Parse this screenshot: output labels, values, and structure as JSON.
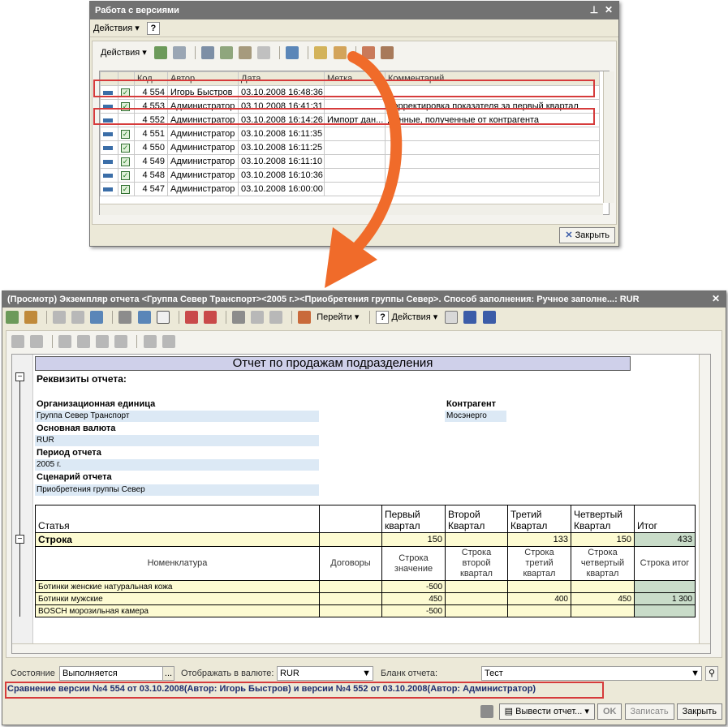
{
  "versions_window": {
    "title": "Работа с версиями",
    "menu_actions": "Действия",
    "toolbar_actions": "Действия",
    "help": "?",
    "columns": [
      "Код",
      "Автор",
      "Дата",
      "Метка",
      "Комментарий"
    ],
    "rows": [
      {
        "code": "4 554",
        "author": "Игорь Быстров",
        "date": "03.10.2008 16:48:36",
        "mark": "",
        "comment": "",
        "checked": true
      },
      {
        "code": "4 553",
        "author": "Администратор",
        "date": "03.10.2008 16:41:31",
        "mark": "",
        "comment": "Корректировка показателя за первый квартал",
        "checked": true
      },
      {
        "code": "4 552",
        "author": "Администратор",
        "date": "03.10.2008 16:14:26",
        "mark": "Импорт дан...",
        "comment": "Данные, полученные от контрагента",
        "checked": false
      },
      {
        "code": "4 551",
        "author": "Администратор",
        "date": "03.10.2008 16:11:35",
        "mark": "",
        "comment": "",
        "checked": true
      },
      {
        "code": "4 550",
        "author": "Администратор",
        "date": "03.10.2008 16:11:25",
        "mark": "",
        "comment": "",
        "checked": true
      },
      {
        "code": "4 549",
        "author": "Администратор",
        "date": "03.10.2008 16:11:10",
        "mark": "",
        "comment": "",
        "checked": true
      },
      {
        "code": "4 548",
        "author": "Администратор",
        "date": "03.10.2008 16:10:36",
        "mark": "",
        "comment": "",
        "checked": true
      },
      {
        "code": "4 547",
        "author": "Администратор",
        "date": "03.10.2008 16:00:00",
        "mark": "",
        "comment": "",
        "checked": true
      }
    ],
    "close_button": "Закрыть"
  },
  "report_window": {
    "title": "(Просмотр) Экземпляр отчета <Группа Север Транспорт><2005 г.><Приобретения группы Север>. Способ заполнения: Ручное заполне...: RUR",
    "toolbar_goto": "Перейти",
    "toolbar_actions": "Действия",
    "help": "?",
    "report_title": "Отчет по продажам подразделения",
    "requisites_header": "Реквизиты отчета:",
    "org_unit_label": "Организационная единица",
    "org_unit_value": "Группа Север Транспорт",
    "currency_label": "Основная валюта",
    "currency_value": "RUR",
    "period_label": "Период отчета",
    "period_value": "2005 г.",
    "scenario_label": "Сценарий отчета",
    "scenario_value": "Приобретения группы Север",
    "counterparty_label": "Контрагент",
    "counterparty_value": "Мосэнерго",
    "table": {
      "col_article": "Статья",
      "col_q1": "Первый квартал",
      "col_q2": "Второй Квартал",
      "col_q3": "Третий Квартал",
      "col_q4": "Четвертый Квартал",
      "col_total": "Итог",
      "row_label": "Строка",
      "row_q1": "150",
      "row_q3": "133",
      "row_q4": "150",
      "row_total": "433",
      "sub_nomenclature": "Номенклатура",
      "sub_contracts": "Договоры",
      "sub_q1": "Строка значение",
      "sub_q2": "Строка второй квартал",
      "sub_q3": "Строка третий квартал",
      "sub_q4": "Строка четвертый квартал",
      "sub_total": "Строка итог",
      "items": [
        {
          "name": "Ботинки женские натуральная кожа",
          "q1": "-500",
          "q3": "",
          "q4": "",
          "total": ""
        },
        {
          "name": "Ботинки мужские",
          "q1": "450",
          "q3": "400",
          "q4": "450",
          "total": "1 300"
        },
        {
          "name": "BOSCH морозильная камера",
          "q1": "-500",
          "q3": "",
          "q4": "",
          "total": ""
        }
      ]
    },
    "state_label": "Состояние",
    "state_value": "Выполняется",
    "currency_display_label": "Отображать в валюте:",
    "currency_display_value": "RUR",
    "form_label": "Бланк отчета:",
    "form_value": "Тест",
    "comparison_text": "Сравнение версии №4 554 от 03.10.2008(Автор: Игорь Быстров) и версии №4 552 от 03.10.2008(Автор: Администратор)",
    "btn_output": "Вывести отчет...",
    "btn_ok": "OK",
    "btn_save": "Записать",
    "btn_close": "Закрыть"
  },
  "colors": {
    "titlebar": "#727272",
    "highlight": "#d63b3b",
    "arrow": "#f06b2a",
    "field": "#dce9f5",
    "yellow": "#fdfbd2",
    "green": "#c9dcc9"
  }
}
